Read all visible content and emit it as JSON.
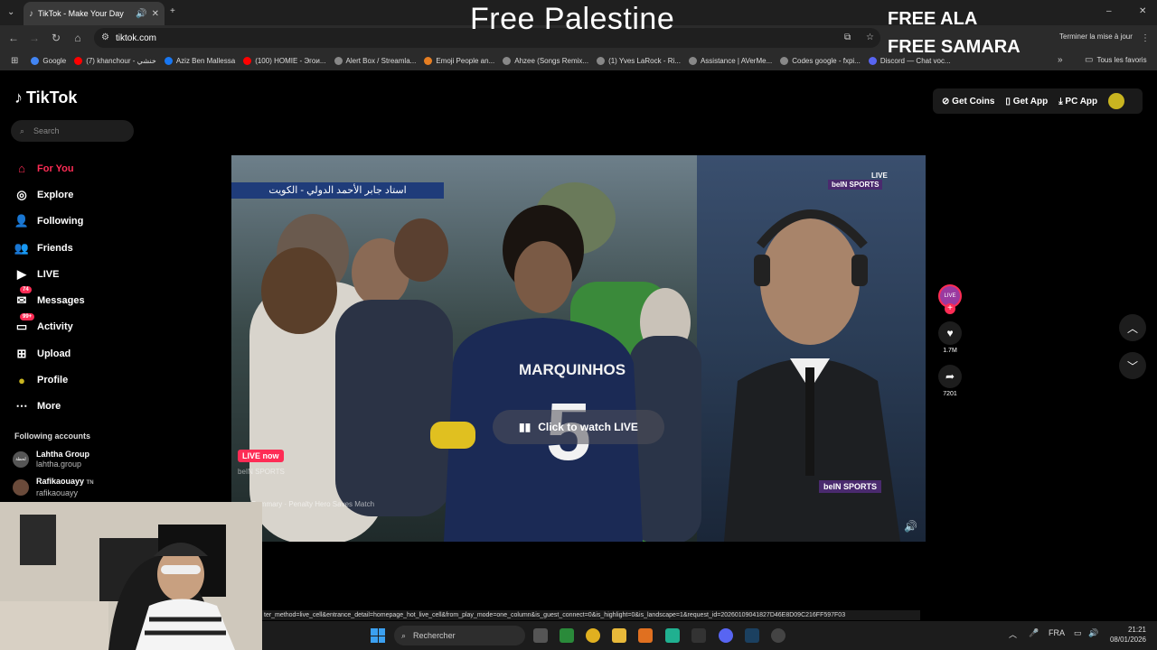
{
  "browser": {
    "tab_title": "TikTok - Make Your Day",
    "url": "tiktok.com",
    "update_label": "Terminer la mise à jour",
    "bookmarks": [
      {
        "label": "Google",
        "color": "#4285f4"
      },
      {
        "label": "(7) khanchour - خنشي",
        "color": "#ff0000"
      },
      {
        "label": "Aziz Ben Mallessa",
        "color": "#1877f2"
      },
      {
        "label": "(100) HOMIE - Эгои...",
        "color": "#ff0000"
      },
      {
        "label": "Alert Box / Streamla...",
        "color": "#888888"
      },
      {
        "label": "Emoji People an...",
        "color": "#e67e22"
      },
      {
        "label": "Ahzee (Songs Remix...",
        "color": "#888888"
      },
      {
        "label": "(1) Yves LaRock - Ri...",
        "color": "#888888"
      },
      {
        "label": "Assistance | AVerMe...",
        "color": "#888888"
      },
      {
        "label": "Codes google - fxpi...",
        "color": "#888888"
      },
      {
        "label": "Discord — Chat voc...",
        "color": "#5865f2"
      }
    ],
    "all_favorites": "Tous les favoris"
  },
  "overlay": {
    "center": "Free Palestine",
    "right_line1": "FREE ALA",
    "right_line2": "FREE SAMARA"
  },
  "tiktok": {
    "logo": "TikTok",
    "search_placeholder": "Search",
    "menu": [
      {
        "label": "For You",
        "icon": "home-icon",
        "glyph": "⌂",
        "active": true
      },
      {
        "label": "Explore",
        "icon": "compass-icon",
        "glyph": "◎"
      },
      {
        "label": "Following",
        "icon": "following-icon",
        "glyph": "👤"
      },
      {
        "label": "Friends",
        "icon": "friends-icon",
        "glyph": "👥"
      },
      {
        "label": "LIVE",
        "icon": "live-icon",
        "glyph": "▶"
      },
      {
        "label": "Messages",
        "icon": "messages-icon",
        "glyph": "✉",
        "badge": "74"
      },
      {
        "label": "Activity",
        "icon": "activity-icon",
        "glyph": "▭",
        "badge": "99+"
      },
      {
        "label": "Upload",
        "icon": "upload-icon",
        "glyph": "⊞"
      },
      {
        "label": "Profile",
        "icon": "profile-avatar-icon",
        "glyph": "●"
      },
      {
        "label": "More",
        "icon": "more-icon",
        "glyph": "⋯"
      }
    ],
    "following_title": "Following accounts",
    "accounts": [
      {
        "name": "Lahtha Group",
        "handle": "lahtha.group"
      },
      {
        "name": "Rafikaouayy",
        "handle": "rafikaouayy",
        "suffix": "TN"
      }
    ],
    "top_buttons": [
      "Get Coins",
      "Get App",
      "PC App"
    ],
    "video": {
      "arabic_caption": "استاد جابر الأحمد الدولي - الكويت",
      "player_name": "MARQUINHOS",
      "player_number": "5",
      "watch_live": "Click to watch LIVE",
      "live_badge": "LIVE now",
      "channel_top": "beIN SPORTS",
      "channel_bottom": "beIN SPORTS",
      "live_tag": "LIVE",
      "subtitle_line1": "beIN SPORTS",
      "subtitle_line2": "Summary · Penalty Hero Saves Match"
    },
    "likes": "1.7M",
    "shares": "7201",
    "live_mini": "LIVE"
  },
  "status_url": "ter_method=live_cell&entrance_detail=homepage_hot_live_cell&from_play_mode=one_column&is_guest_connect=0&is_highlight=0&is_landscape=1&request_id=20260109041827D46E8D09C216FF597F03",
  "taskbar": {
    "search": "Rechercher",
    "lang": "FRA",
    "time": "21:21",
    "date": "08/01/2026"
  }
}
